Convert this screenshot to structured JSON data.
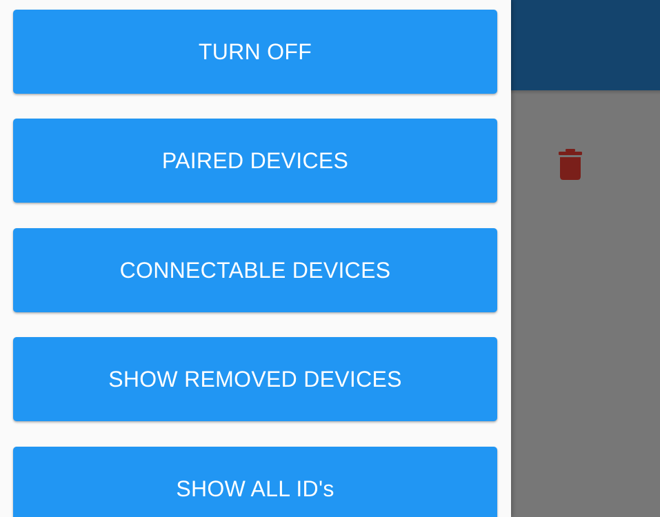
{
  "colors": {
    "appbar": "#14446d",
    "scrim_background": "#777777",
    "drawer_background": "#fafafa",
    "button": "#2196f3",
    "button_text": "#ffffff",
    "trash_icon": "#7a1f1a"
  },
  "background": {
    "action_icon": "trash-icon"
  },
  "drawer": {
    "buttons": [
      {
        "label": "TURN OFF"
      },
      {
        "label": "PAIRED DEVICES"
      },
      {
        "label": "CONNECTABLE DEVICES"
      },
      {
        "label": "SHOW REMOVED DEVICES"
      },
      {
        "label": "SHOW ALL ID's"
      }
    ]
  }
}
